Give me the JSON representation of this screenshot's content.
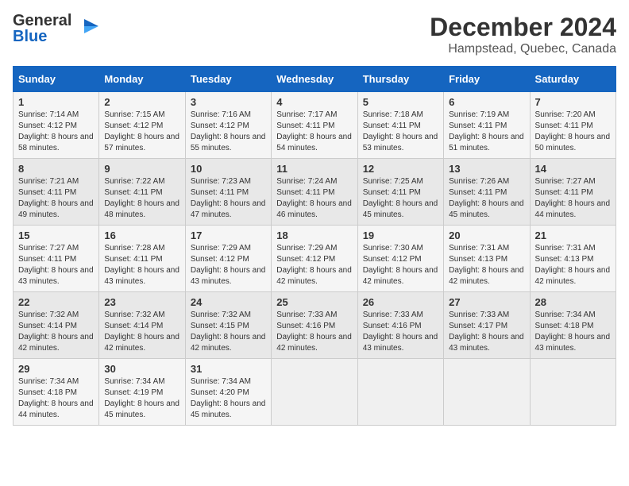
{
  "header": {
    "logo_general": "General",
    "logo_blue": "Blue",
    "title": "December 2024",
    "subtitle": "Hampstead, Quebec, Canada"
  },
  "columns": [
    "Sunday",
    "Monday",
    "Tuesday",
    "Wednesday",
    "Thursday",
    "Friday",
    "Saturday"
  ],
  "weeks": [
    [
      {
        "day": "1",
        "sunrise": "Sunrise: 7:14 AM",
        "sunset": "Sunset: 4:12 PM",
        "daylight": "Daylight: 8 hours and 58 minutes."
      },
      {
        "day": "2",
        "sunrise": "Sunrise: 7:15 AM",
        "sunset": "Sunset: 4:12 PM",
        "daylight": "Daylight: 8 hours and 57 minutes."
      },
      {
        "day": "3",
        "sunrise": "Sunrise: 7:16 AM",
        "sunset": "Sunset: 4:12 PM",
        "daylight": "Daylight: 8 hours and 55 minutes."
      },
      {
        "day": "4",
        "sunrise": "Sunrise: 7:17 AM",
        "sunset": "Sunset: 4:11 PM",
        "daylight": "Daylight: 8 hours and 54 minutes."
      },
      {
        "day": "5",
        "sunrise": "Sunrise: 7:18 AM",
        "sunset": "Sunset: 4:11 PM",
        "daylight": "Daylight: 8 hours and 53 minutes."
      },
      {
        "day": "6",
        "sunrise": "Sunrise: 7:19 AM",
        "sunset": "Sunset: 4:11 PM",
        "daylight": "Daylight: 8 hours and 51 minutes."
      },
      {
        "day": "7",
        "sunrise": "Sunrise: 7:20 AM",
        "sunset": "Sunset: 4:11 PM",
        "daylight": "Daylight: 8 hours and 50 minutes."
      }
    ],
    [
      {
        "day": "8",
        "sunrise": "Sunrise: 7:21 AM",
        "sunset": "Sunset: 4:11 PM",
        "daylight": "Daylight: 8 hours and 49 minutes."
      },
      {
        "day": "9",
        "sunrise": "Sunrise: 7:22 AM",
        "sunset": "Sunset: 4:11 PM",
        "daylight": "Daylight: 8 hours and 48 minutes."
      },
      {
        "day": "10",
        "sunrise": "Sunrise: 7:23 AM",
        "sunset": "Sunset: 4:11 PM",
        "daylight": "Daylight: 8 hours and 47 minutes."
      },
      {
        "day": "11",
        "sunrise": "Sunrise: 7:24 AM",
        "sunset": "Sunset: 4:11 PM",
        "daylight": "Daylight: 8 hours and 46 minutes."
      },
      {
        "day": "12",
        "sunrise": "Sunrise: 7:25 AM",
        "sunset": "Sunset: 4:11 PM",
        "daylight": "Daylight: 8 hours and 45 minutes."
      },
      {
        "day": "13",
        "sunrise": "Sunrise: 7:26 AM",
        "sunset": "Sunset: 4:11 PM",
        "daylight": "Daylight: 8 hours and 45 minutes."
      },
      {
        "day": "14",
        "sunrise": "Sunrise: 7:27 AM",
        "sunset": "Sunset: 4:11 PM",
        "daylight": "Daylight: 8 hours and 44 minutes."
      }
    ],
    [
      {
        "day": "15",
        "sunrise": "Sunrise: 7:27 AM",
        "sunset": "Sunset: 4:11 PM",
        "daylight": "Daylight: 8 hours and 43 minutes."
      },
      {
        "day": "16",
        "sunrise": "Sunrise: 7:28 AM",
        "sunset": "Sunset: 4:11 PM",
        "daylight": "Daylight: 8 hours and 43 minutes."
      },
      {
        "day": "17",
        "sunrise": "Sunrise: 7:29 AM",
        "sunset": "Sunset: 4:12 PM",
        "daylight": "Daylight: 8 hours and 43 minutes."
      },
      {
        "day": "18",
        "sunrise": "Sunrise: 7:29 AM",
        "sunset": "Sunset: 4:12 PM",
        "daylight": "Daylight: 8 hours and 42 minutes."
      },
      {
        "day": "19",
        "sunrise": "Sunrise: 7:30 AM",
        "sunset": "Sunset: 4:12 PM",
        "daylight": "Daylight: 8 hours and 42 minutes."
      },
      {
        "day": "20",
        "sunrise": "Sunrise: 7:31 AM",
        "sunset": "Sunset: 4:13 PM",
        "daylight": "Daylight: 8 hours and 42 minutes."
      },
      {
        "day": "21",
        "sunrise": "Sunrise: 7:31 AM",
        "sunset": "Sunset: 4:13 PM",
        "daylight": "Daylight: 8 hours and 42 minutes."
      }
    ],
    [
      {
        "day": "22",
        "sunrise": "Sunrise: 7:32 AM",
        "sunset": "Sunset: 4:14 PM",
        "daylight": "Daylight: 8 hours and 42 minutes."
      },
      {
        "day": "23",
        "sunrise": "Sunrise: 7:32 AM",
        "sunset": "Sunset: 4:14 PM",
        "daylight": "Daylight: 8 hours and 42 minutes."
      },
      {
        "day": "24",
        "sunrise": "Sunrise: 7:32 AM",
        "sunset": "Sunset: 4:15 PM",
        "daylight": "Daylight: 8 hours and 42 minutes."
      },
      {
        "day": "25",
        "sunrise": "Sunrise: 7:33 AM",
        "sunset": "Sunset: 4:16 PM",
        "daylight": "Daylight: 8 hours and 42 minutes."
      },
      {
        "day": "26",
        "sunrise": "Sunrise: 7:33 AM",
        "sunset": "Sunset: 4:16 PM",
        "daylight": "Daylight: 8 hours and 43 minutes."
      },
      {
        "day": "27",
        "sunrise": "Sunrise: 7:33 AM",
        "sunset": "Sunset: 4:17 PM",
        "daylight": "Daylight: 8 hours and 43 minutes."
      },
      {
        "day": "28",
        "sunrise": "Sunrise: 7:34 AM",
        "sunset": "Sunset: 4:18 PM",
        "daylight": "Daylight: 8 hours and 43 minutes."
      }
    ],
    [
      {
        "day": "29",
        "sunrise": "Sunrise: 7:34 AM",
        "sunset": "Sunset: 4:18 PM",
        "daylight": "Daylight: 8 hours and 44 minutes."
      },
      {
        "day": "30",
        "sunrise": "Sunrise: 7:34 AM",
        "sunset": "Sunset: 4:19 PM",
        "daylight": "Daylight: 8 hours and 45 minutes."
      },
      {
        "day": "31",
        "sunrise": "Sunrise: 7:34 AM",
        "sunset": "Sunset: 4:20 PM",
        "daylight": "Daylight: 8 hours and 45 minutes."
      },
      null,
      null,
      null,
      null
    ]
  ]
}
